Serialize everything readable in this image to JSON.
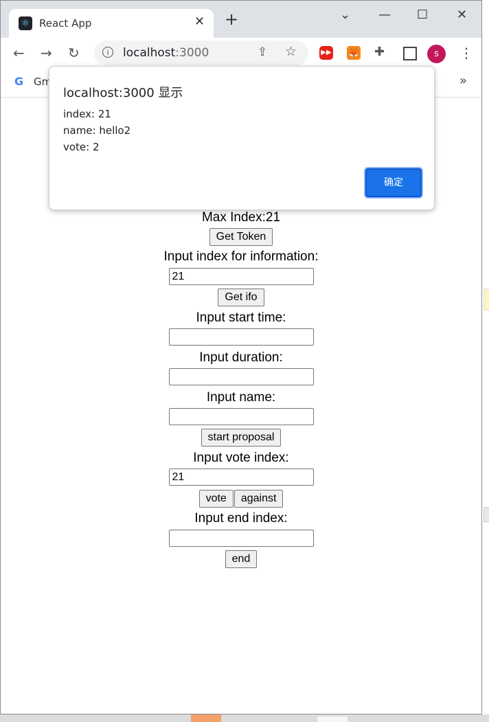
{
  "browser": {
    "tab_title": "React App",
    "tab_close": "✕",
    "new_tab": "+",
    "url_host": "localhost",
    "url_port": ":3000",
    "avatar_letter": "s",
    "bookmark_label": "Gm",
    "bookmark_more": "»"
  },
  "dialog": {
    "title": "localhost:3000 显示",
    "lines": [
      "index: 21",
      "name: hello2",
      "vote: 2"
    ],
    "ok_label": "确定"
  },
  "app": {
    "max_index_text": "Max Index:21",
    "get_token_label": "Get Token",
    "info_label": "Input index for information:",
    "info_value": "21",
    "get_info_label": "Get ifo",
    "start_time_label": "Input start time:",
    "start_time_value": "",
    "duration_label": "Input duration:",
    "duration_value": "",
    "name_label": "Input name:",
    "name_value": "",
    "start_proposal_label": "start proposal",
    "vote_index_label": "Input vote index:",
    "vote_index_value": "21",
    "vote_label": "vote",
    "against_label": "against",
    "end_index_label": "Input end index:",
    "end_index_value": "",
    "end_label": "end"
  },
  "colors": {
    "accent": "#1a73e8",
    "avatar": "#c2185b"
  }
}
